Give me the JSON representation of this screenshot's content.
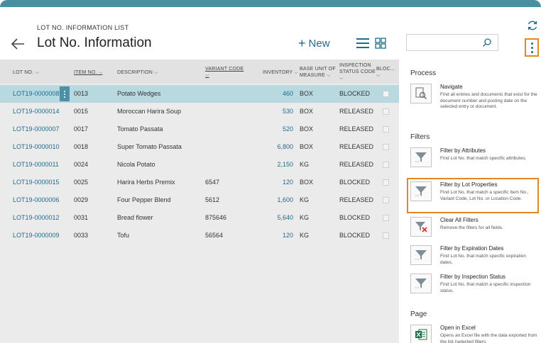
{
  "header": {
    "caption": "LOT NO. INFORMATION LIST",
    "title": "Lot No. Information",
    "new_label": "New"
  },
  "columns": {
    "lot_no": "LOT NO.",
    "item_no": "ITEM NO.",
    "description": "DESCRIPTION",
    "variant_code": "VARIANT CODE",
    "inventory": "INVENTORY",
    "base_unit_1": "BASE UNIT OF",
    "base_unit_2": "MEASURE",
    "inspection_1": "INSPECTION",
    "inspection_2": "STATUS CODE",
    "blocked": "BLOC..."
  },
  "rows": [
    {
      "lot": "LOT19-0000008",
      "item": "0013",
      "desc": "Potato Wedges",
      "variant": "",
      "inv": "460",
      "uom": "BOX",
      "status": "BLOCKED"
    },
    {
      "lot": "LOT19-0000014",
      "item": "0015",
      "desc": "Moroccan Harira Soup",
      "variant": "",
      "inv": "530",
      "uom": "BOX",
      "status": "RELEASED"
    },
    {
      "lot": "LOT19-0000007",
      "item": "0017",
      "desc": "Tomato Passata",
      "variant": "",
      "inv": "520",
      "uom": "BOX",
      "status": "RELEASED"
    },
    {
      "lot": "LOT19-0000010",
      "item": "0018",
      "desc": "Super Tomato Passata",
      "variant": "",
      "inv": "6,800",
      "uom": "BOX",
      "status": "RELEASED"
    },
    {
      "lot": "LOT19-0000011",
      "item": "0024",
      "desc": "Nicola Potato",
      "variant": "",
      "inv": "2,150",
      "uom": "KG",
      "status": "RELEASED"
    },
    {
      "lot": "LOT19-0000015",
      "item": "0025",
      "desc": "Harira Herbs Premix",
      "variant": "6547",
      "inv": "120",
      "uom": "BOX",
      "status": "BLOCKED"
    },
    {
      "lot": "LOT19-0000006",
      "item": "0029",
      "desc": "Four Pepper Blend",
      "variant": "5612",
      "inv": "1,600",
      "uom": "KG",
      "status": "RELEASED"
    },
    {
      "lot": "LOT19-0000012",
      "item": "0031",
      "desc": "Bread flower",
      "variant": "875646",
      "inv": "5,640",
      "uom": "KG",
      "status": "BLOCKED"
    },
    {
      "lot": "LOT19-0000009",
      "item": "0033",
      "desc": "Tofu",
      "variant": "56564",
      "inv": "120",
      "uom": "KG",
      "status": "BLOCKED"
    }
  ],
  "panel": {
    "groups": {
      "process": "Process",
      "filters": "Filters",
      "page": "Page"
    },
    "actions": [
      {
        "name": "Navigate",
        "desc": "Find all entries and documents that exist for the document number and posting date on the selected entry or document.",
        "icon": "navigate-icon"
      },
      {
        "name": "Filter by Attributes",
        "desc": "Find Lot No. that match specific attributes.",
        "icon": "filter-icon"
      },
      {
        "name": "Filter by Lot Properties",
        "desc": "Find Lot No. that match a specific Item No., Variant Code, Lot No. or Location Code.",
        "icon": "filter-icon"
      },
      {
        "name": "Clear All Filters",
        "desc": "Remove the filters for all fields.",
        "icon": "clear-filter-icon"
      },
      {
        "name": "Filter by Expiration Dates",
        "desc": "Find Lot No. that match specific expiration dates.",
        "icon": "filter-icon"
      },
      {
        "name": "Filter by Inspection Status",
        "desc": "Find Lot No. that match a specific inspection status.",
        "icon": "filter-icon"
      },
      {
        "name": "Open in Excel",
        "desc": "Opens an Excel file with the data exported from the list (selected filters",
        "icon": "excel-icon"
      }
    ]
  },
  "colors": {
    "accent": "#1f6c8a",
    "highlight": "#e08a1e",
    "selected_row": "#b7d9df",
    "topbar": "#4a8fa0"
  }
}
